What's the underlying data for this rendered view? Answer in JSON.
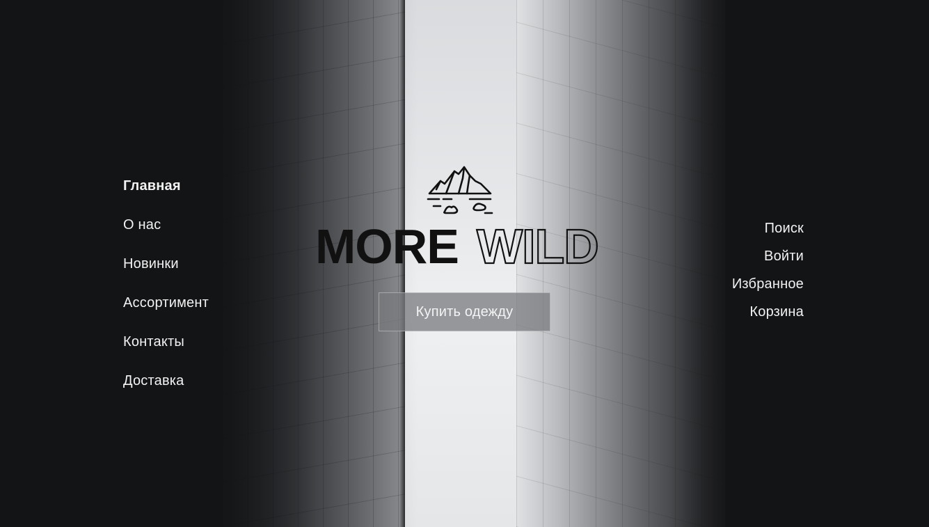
{
  "brand": {
    "word_solid": "MORE",
    "word_outline": "WILD",
    "logo_icon": "mountain-iceberg-icon"
  },
  "nav_left": {
    "items": [
      {
        "label": "Главная",
        "active": true
      },
      {
        "label": "О нас",
        "active": false
      },
      {
        "label": "Новинки",
        "active": false
      },
      {
        "label": "Ассортимент",
        "active": false
      },
      {
        "label": "Контакты",
        "active": false
      },
      {
        "label": "Доставка",
        "active": false
      }
    ]
  },
  "nav_right": {
    "items": [
      {
        "label": "Поиск"
      },
      {
        "label": "Войти"
      },
      {
        "label": "Избранное"
      },
      {
        "label": "Корзина"
      }
    ]
  },
  "hero": {
    "cta_label": "Купить одежду"
  },
  "colors": {
    "background": "#131416",
    "text": "#f2f2f2",
    "cta_bg": "#787a7d",
    "logo": "#111111"
  }
}
